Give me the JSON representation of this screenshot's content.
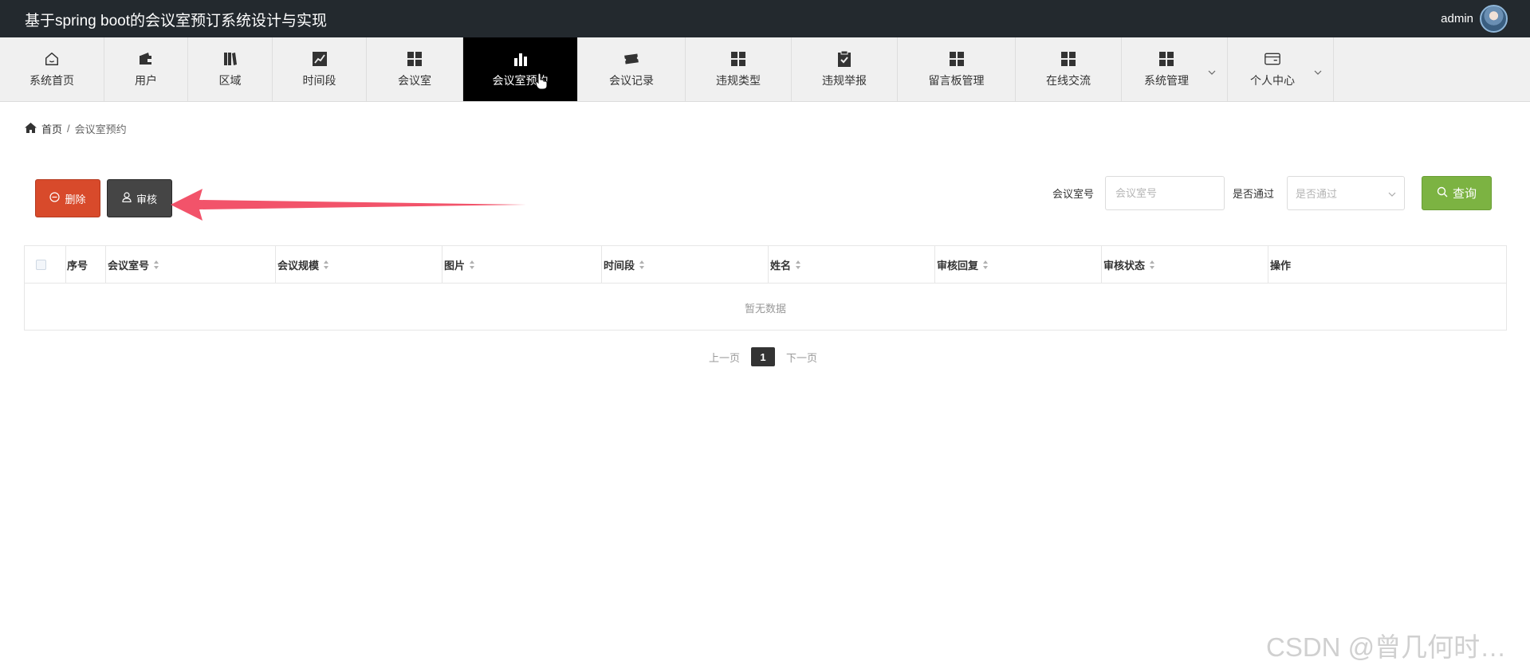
{
  "app": {
    "title": "基于spring boot的会议室预订系统设计与实现",
    "username": "admin"
  },
  "nav": {
    "items": [
      {
        "label": "系统首页",
        "icon": "home-icon"
      },
      {
        "label": "用户",
        "icon": "wallet-icon"
      },
      {
        "label": "区域",
        "icon": "book-icon"
      },
      {
        "label": "时间段",
        "icon": "chart-line-icon"
      },
      {
        "label": "会议室",
        "icon": "grid-icon"
      },
      {
        "label": "会议室预约",
        "icon": "bar-chart-icon",
        "active": true
      },
      {
        "label": "会议记录",
        "icon": "ticket-icon"
      },
      {
        "label": "违规类型",
        "icon": "grid-icon"
      },
      {
        "label": "违规举报",
        "icon": "clipboard-check-icon"
      },
      {
        "label": "留言板管理",
        "icon": "grid-icon"
      },
      {
        "label": "在线交流",
        "icon": "grid-icon"
      },
      {
        "label": "系统管理",
        "icon": "grid-icon",
        "dropdown": true
      },
      {
        "label": "个人中心",
        "icon": "card-icon",
        "dropdown": true
      }
    ]
  },
  "breadcrumb": {
    "home": "首页",
    "separator": "/",
    "current": "会议室预约"
  },
  "actions": {
    "delete_label": "删除",
    "audit_label": "审核"
  },
  "search": {
    "room_label": "会议室号",
    "room_placeholder": "会议室号",
    "approved_label": "是否通过",
    "approved_placeholder": "是否通过",
    "query_label": "查询"
  },
  "table": {
    "columns": [
      "序号",
      "会议室号",
      "会议规模",
      "图片",
      "时间段",
      "姓名",
      "审核回复",
      "审核状态",
      "操作"
    ],
    "empty_text": "暂无数据"
  },
  "pagination": {
    "prev": "上一页",
    "current": "1",
    "next": "下一页"
  },
  "watermark": "CSDN @曾几何时…",
  "colors": {
    "topbar": "#23292e",
    "active_nav": "#000000",
    "delete": "#d84a2b",
    "audit": "#454545",
    "query": "#7cb342",
    "arrow": "#f2536a"
  }
}
